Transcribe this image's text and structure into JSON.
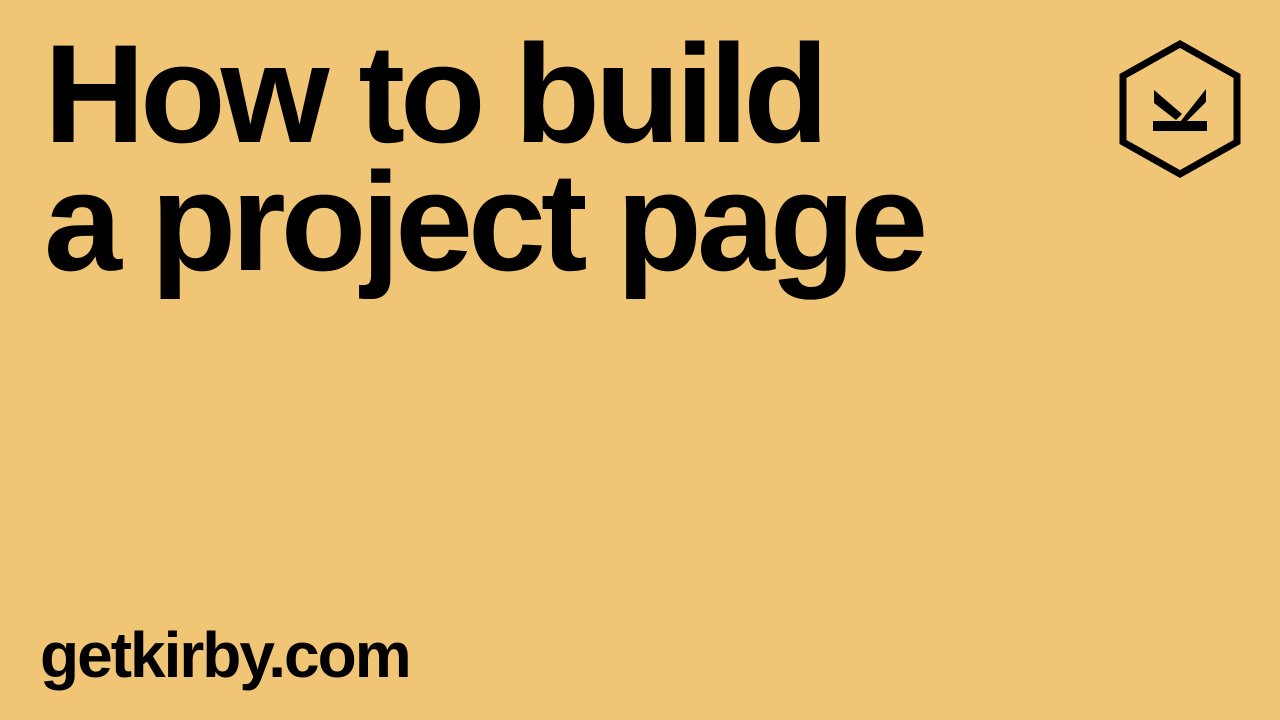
{
  "title": {
    "line1": "How to build",
    "line2": "a project page"
  },
  "logo": {
    "icon": "kirby-hexagon-logo",
    "letter": "K"
  },
  "footer": {
    "url": "getkirby.com"
  },
  "colors": {
    "background": "#f0c575",
    "text": "#000000"
  }
}
